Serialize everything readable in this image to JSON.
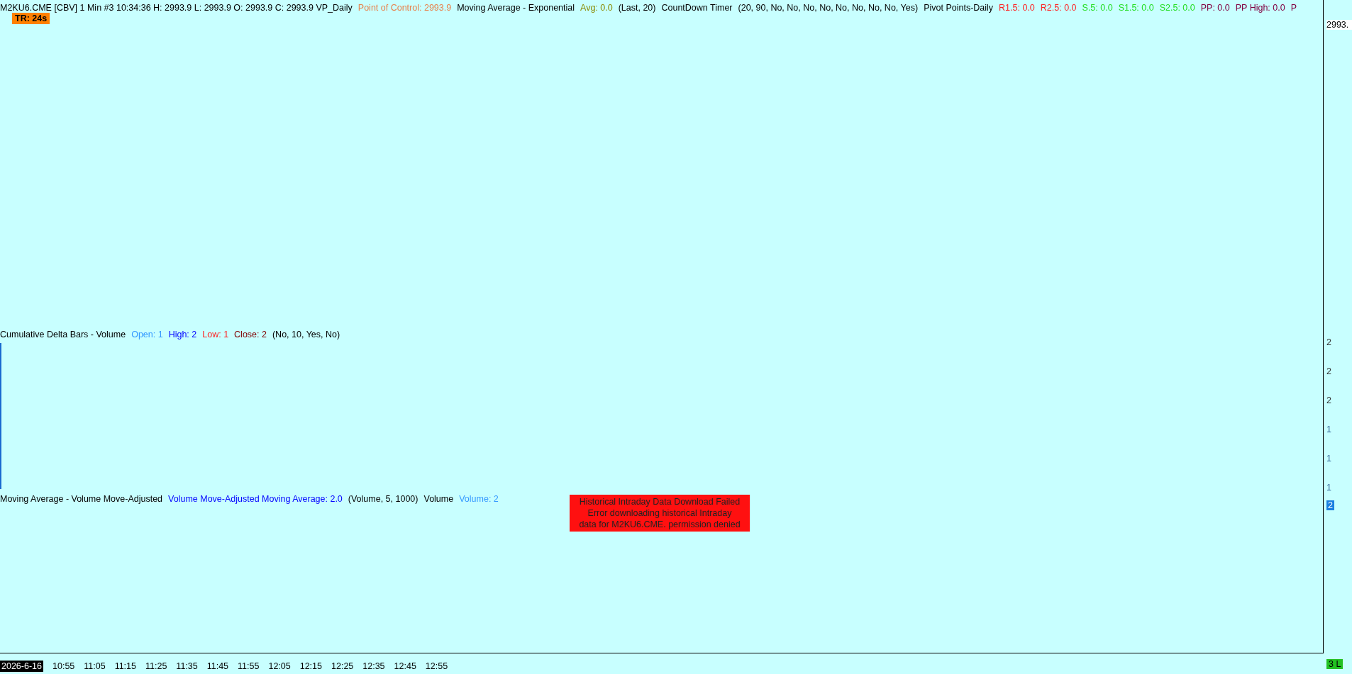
{
  "price_pane": {
    "segments": [
      {
        "text": "M2KU6.CME [CBV]  1 Min  #3 10:34:36 H: 2993.9 L: 2993.9 O: 2993.9 C: 2993.9 VP_Daily",
        "color": "#000000"
      },
      {
        "text": "Point of Control: 2993.9",
        "color": "#e8804a"
      },
      {
        "text": "Moving Average - Exponential",
        "color": "#000000"
      },
      {
        "text": "Avg: 0.0",
        "color": "#8a8a00"
      },
      {
        "text": "(Last, 20)",
        "color": "#000000"
      },
      {
        "text": "CountDown Timer",
        "color": "#000000"
      },
      {
        "text": "(20, 90, No, No, No, No, No, No, No, No, Yes)",
        "color": "#000000"
      },
      {
        "text": "Pivot Points-Daily",
        "color": "#000000"
      },
      {
        "text": "R1.5: 0.0",
        "color": "#ff2020"
      },
      {
        "text": "R2.5: 0.0",
        "color": "#ff2020"
      },
      {
        "text": "S.5: 0.0",
        "color": "#22dd22"
      },
      {
        "text": "S1.5: 0.0",
        "color": "#22dd22"
      },
      {
        "text": "S2.5: 0.0",
        "color": "#22dd22"
      },
      {
        "text": "PP: 0.0",
        "color": "#800040"
      },
      {
        "text": "PP High: 0.0",
        "color": "#800040"
      },
      {
        "text": "P",
        "color": "#800040"
      }
    ],
    "timer_badge": "TR: 24s",
    "axis_label": "2993."
  },
  "delta_pane": {
    "segments": [
      {
        "text": "Cumulative Delta Bars - Volume",
        "color": "#000000"
      },
      {
        "text": "Open: 1",
        "color": "#3399ff"
      },
      {
        "text": "High: 2",
        "color": "#0000ff"
      },
      {
        "text": "Low: 1",
        "color": "#ff2020"
      },
      {
        "text": "Close: 2",
        "color": "#800000"
      },
      {
        "text": "(No, 10, Yes, No)",
        "color": "#000000"
      }
    ],
    "axis_labels": [
      "2",
      "2",
      "2",
      "1",
      "1",
      "1"
    ]
  },
  "volume_pane": {
    "segments": [
      {
        "text": "Moving Average - Volume Move-Adjusted",
        "color": "#000000"
      },
      {
        "text": "Volume Move-Adjusted Moving Average: 2.0",
        "color": "#0000ff"
      },
      {
        "text": "(Volume, 5, 1000)",
        "color": "#000000"
      },
      {
        "text": "Volume",
        "color": "#000000"
      },
      {
        "text": "Volume: 2",
        "color": "#3399ff"
      }
    ],
    "value_marker": "2",
    "error_lines": [
      "Historical Intraday Data Download Failed",
      "Error downloading historical Intraday",
      "data for M2KU6.CME. permission denied"
    ]
  },
  "time_axis": {
    "date": "2026-6-16",
    "times": [
      "10:55",
      "11:05",
      "11:15",
      "11:25",
      "11:35",
      "11:45",
      "11:55",
      "12:05",
      "12:15",
      "12:25",
      "12:35",
      "12:45",
      "12:55"
    ],
    "status": "3 L"
  }
}
